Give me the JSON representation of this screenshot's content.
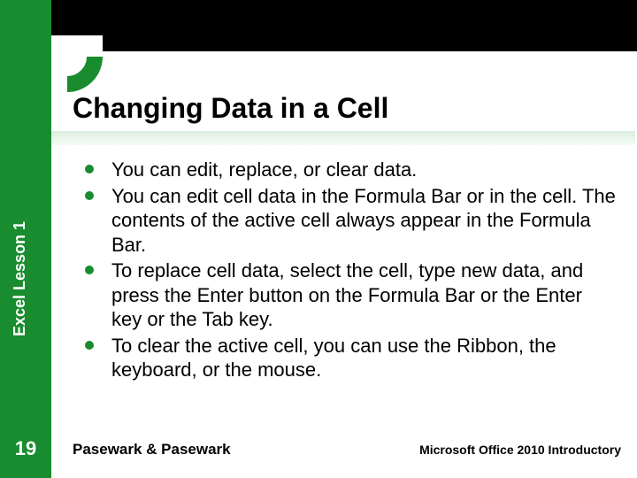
{
  "sidebar": {
    "label": "Excel Lesson 1",
    "slide_number": "19"
  },
  "title": "Changing Data in a Cell",
  "bullets": [
    "You can edit, replace, or clear data.",
    "You can edit cell data in the Formula Bar or in the cell. The contents of the active cell always appear in the Formula Bar.",
    "To replace cell data, select the cell, type new data, and press the Enter button on the Formula Bar or the Enter key or the Tab key.",
    "To clear the active cell, you can use the Ribbon, the keyboard, or the mouse."
  ],
  "footer": {
    "left": "Pasewark & Pasewark",
    "right": "Microsoft Office 2010 Introductory"
  }
}
